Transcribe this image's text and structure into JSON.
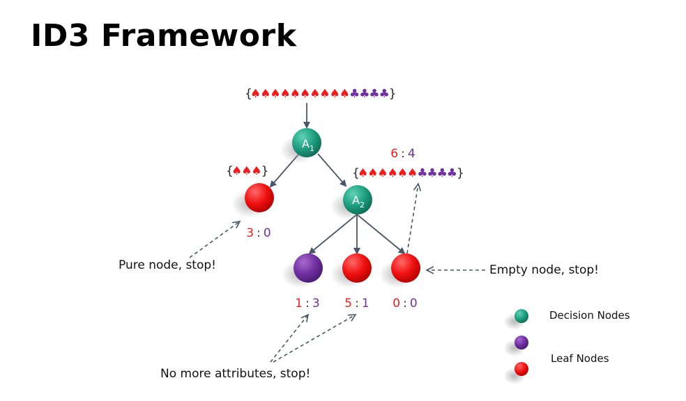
{
  "title": "ID3 Framework",
  "colors": {
    "red": "#ee1c1c",
    "purple": "#7030a0",
    "teal": "#1e9e80",
    "arrow": "#4a5566"
  },
  "sets": {
    "root": {
      "red": 10,
      "purple": 4,
      "open": "{",
      "close": "}"
    },
    "left": {
      "red": 3,
      "purple": 0,
      "open": "{",
      "close": "}"
    },
    "right": {
      "red": 6,
      "purple": 4,
      "open": "{",
      "close": "}"
    }
  },
  "nodes": {
    "a1": {
      "letter": "A",
      "sub": "1"
    },
    "a2": {
      "letter": "A",
      "sub": "2"
    }
  },
  "ratios": {
    "a2_top": {
      "red": "6",
      "sep": ":",
      "purple": "4"
    },
    "left_leaf": {
      "red": "3",
      "sep": ":",
      "purple": "0"
    },
    "leaf_1": {
      "red": "1",
      "sep": ":",
      "purple": "3"
    },
    "leaf_2": {
      "red": "5",
      "sep": ":",
      "purple": "1"
    },
    "leaf_3": {
      "red": "0",
      "sep": ":",
      "purple": "0"
    }
  },
  "annotations": {
    "pure": "Pure node, stop!",
    "empty": "Empty node, stop!",
    "no_attr": "No more attributes, stop!"
  },
  "legend": {
    "decision": "Decision Nodes",
    "leaf": "Leaf Nodes"
  }
}
